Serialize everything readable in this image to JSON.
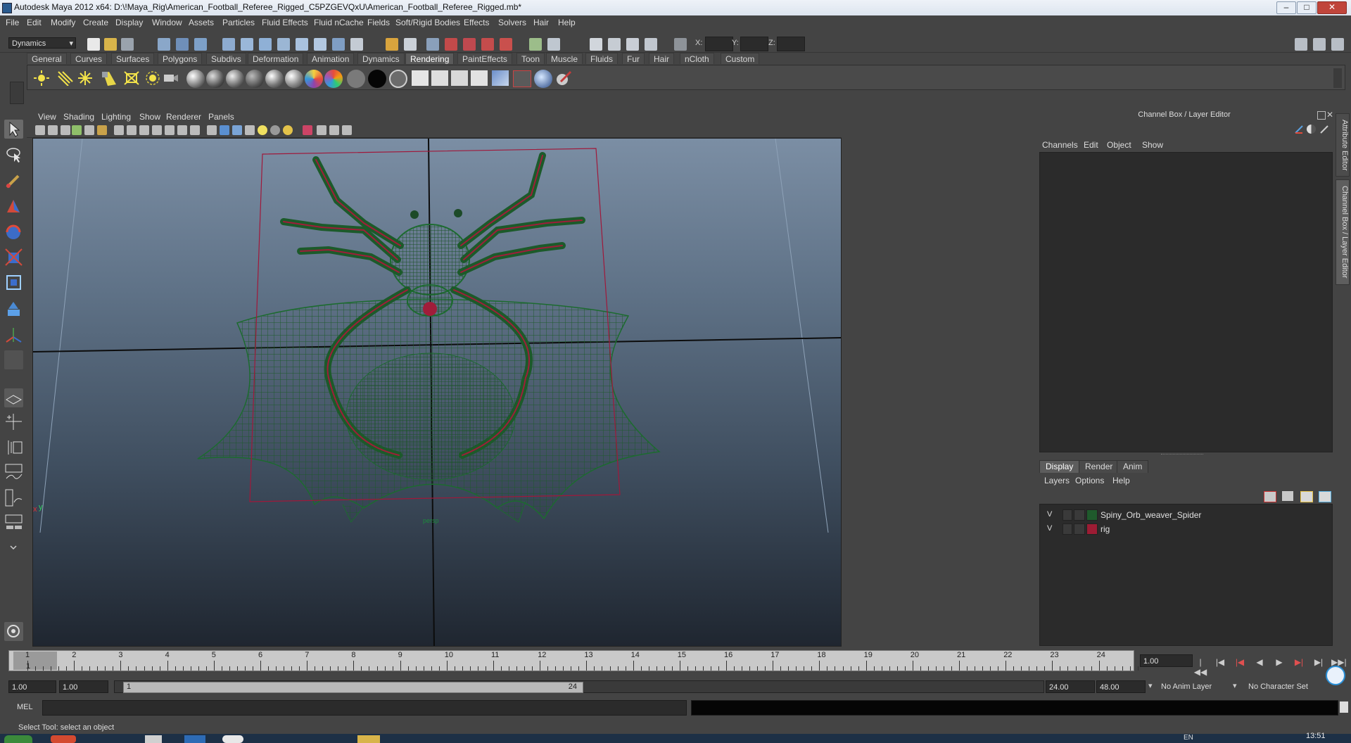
{
  "window": {
    "title": "Autodesk Maya 2012 x64: D:\\!Maya_Rig\\American_Football_Referee_Rigged_C5PZGEVQxU\\American_Football_Referee_Rigged.mb*",
    "controls": [
      "minimize-icon",
      "maximize-icon",
      "close-icon"
    ]
  },
  "menubar": [
    "File",
    "Edit",
    "Modify",
    "Create",
    "Display",
    "Window",
    "Assets",
    "Particles",
    "Fluid Effects",
    "Fluid nCache",
    "Fields",
    "Soft/Rigid Bodies",
    "Effects",
    "Solvers",
    "Hair",
    "Help"
  ],
  "statusline": {
    "mode": "Dynamics",
    "x_label": "X:",
    "y_label": "Y:",
    "z_label": "Z:"
  },
  "shelf": {
    "tabs": [
      "General",
      "Curves",
      "Surfaces",
      "Polygons",
      "Subdivs",
      "Deformation",
      "Animation",
      "Dynamics",
      "Rendering",
      "PaintEffects",
      "Toon",
      "Muscle",
      "Fluids",
      "Fur",
      "Hair",
      "nCloth",
      "Custom"
    ],
    "active_tab": "Rendering"
  },
  "viewport": {
    "menus": [
      "View",
      "Shading",
      "Lighting",
      "Show",
      "Renderer",
      "Panels"
    ],
    "camera_label": "persp",
    "axis_x": "x",
    "axis_y": "y"
  },
  "right_panel": {
    "title": "Channel Box / Layer Editor",
    "channel_menus": [
      "Channels",
      "Edit",
      "Object",
      "Show"
    ],
    "layer_tabs": [
      "Display",
      "Render",
      "Anim"
    ],
    "active_layer_tab": "Display",
    "layer_menus": [
      "Layers",
      "Options",
      "Help"
    ],
    "layers": [
      {
        "visible": "V",
        "name": "Spiny_Orb_weaver_Spider",
        "color": "#1f5a2c"
      },
      {
        "visible": "V",
        "name": "rig",
        "color": "#9c1c34"
      }
    ],
    "side_tabs": [
      "Attribute Editor",
      "Channel Box / Layer Editor"
    ]
  },
  "timeline": {
    "ticks": [
      "1",
      "2",
      "3",
      "4",
      "5",
      "6",
      "7",
      "8",
      "9",
      "10",
      "11",
      "12",
      "13",
      "14",
      "15",
      "16",
      "17",
      "18",
      "19",
      "20",
      "21",
      "22",
      "23",
      "24"
    ],
    "current_frame": "1",
    "current_time_field": "1.00",
    "range_start": "1.00",
    "range_start_inner": "1.00",
    "range_bar_start": "1",
    "range_bar_end": "24",
    "range_end": "24.00",
    "range_end_outer": "48.00",
    "anim_layer": "No Anim Layer",
    "character_set": "No Character Set"
  },
  "command_line": {
    "language": "MEL"
  },
  "help_line": "Select Tool: select an object",
  "taskbar": {
    "clock": "13:51",
    "lang": "EN"
  }
}
